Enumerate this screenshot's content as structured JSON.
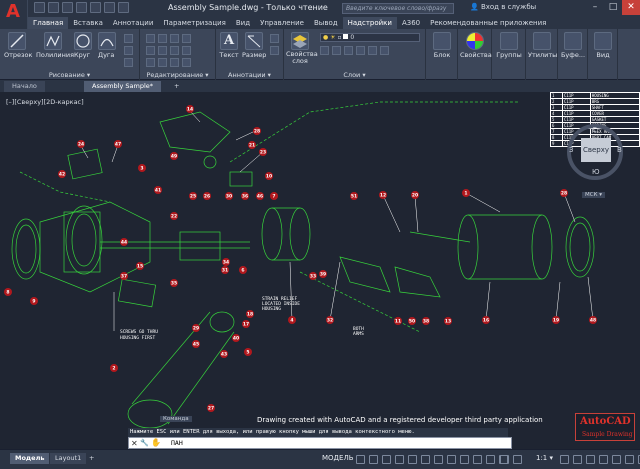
{
  "title_bar": {
    "window_title": "Assembly Sample.dwg - Только чтение",
    "search_placeholder": "Введите ключевое слово/фразу",
    "signin": "Вход в службы",
    "min": "–",
    "max": "□",
    "close": "✕"
  },
  "ribbon_tabs": [
    "Главная",
    "Вставка",
    "Аннотации",
    "Параметризация",
    "Вид",
    "Управление",
    "Вывод",
    "Надстройки",
    "A360",
    "Рекомендованные приложения"
  ],
  "ribbon": {
    "draw": {
      "line": "Отрезок",
      "polyline": "Полилиния",
      "circle": "Круг",
      "arc": "Дуга",
      "group_label": "Рисование ▾"
    },
    "modify": {
      "group_label": "Редактирование ▾"
    },
    "annotation": {
      "text": "Текст",
      "dimension": "Размер",
      "group_label": "Аннотации ▾"
    },
    "layers": {
      "layer_props": "Свойства слоя",
      "layer_value": "0",
      "group_label": "Слои ▾"
    },
    "block": {
      "label": "Блок"
    },
    "properties": {
      "label": "Свойства"
    },
    "groups": {
      "label": "Группы"
    },
    "utilities": {
      "label": "Утилиты"
    },
    "clipboard": {
      "label": "Буфе..."
    },
    "view": {
      "label": "Вид"
    }
  },
  "file_tabs": {
    "start": "Начало",
    "document": "Assembly Sample*",
    "add": "+"
  },
  "canvas": {
    "viewport_label": "[–][Сверху][2D-каркас]",
    "viewcube": {
      "north": "С",
      "south": "Ю",
      "west": "З",
      "east": "В",
      "face": "Сверху",
      "wcs": "МСК ▾"
    },
    "parts_table": [
      [
        "1",
        "C11P",
        "HOUSING"
      ],
      [
        "2",
        "C11P",
        "BRG"
      ],
      [
        "3",
        "C11P",
        "SHAFT"
      ],
      [
        "4",
        "C11P",
        "COVER"
      ],
      [
        "5",
        "C11P",
        "GASKET"
      ],
      [
        "6",
        "C11P",
        "SPRING"
      ],
      [
        "7",
        "C11P",
        "FLEX ARM"
      ],
      [
        "8",
        "C11P",
        "VERT CAM"
      ],
      [
        "9",
        "C11P",
        "RIVET"
      ]
    ],
    "notes": [
      {
        "lines": [
          "SCREWS GO THRU",
          "HOUSING FIRST"
        ]
      },
      {
        "lines": [
          "STRAIN RELIEF",
          "LOCATED INSIDE",
          "HOUSING"
        ]
      },
      {
        "lines": [
          "BOTH",
          "ARMS"
        ]
      }
    ],
    "balloons": [
      "24",
      "47",
      "14",
      "28",
      "21",
      "23",
      "49",
      "10",
      "25",
      "26",
      "30",
      "36",
      "46",
      "7",
      "3",
      "8",
      "9",
      "44",
      "15",
      "37",
      "35",
      "31",
      "6",
      "33",
      "39",
      "32",
      "4",
      "18",
      "17",
      "40",
      "5",
      "2",
      "27",
      "12",
      "20",
      "1",
      "28",
      "16",
      "19",
      "48",
      "11",
      "50",
      "38",
      "13",
      "22",
      "43",
      "29",
      "34",
      "45",
      "42",
      "41",
      "51"
    ],
    "credit": "Drawing created with AutoCAD and a registered developer third party application",
    "logo_title": "AutoCAD",
    "logo_sub": "Sample Drawing"
  },
  "command": {
    "history_label": "Команда",
    "prompt": "Нажмите ESC или ENTER для выхода, или правую кнопку мыши для вывода контекстного меню.",
    "input": "ПАН"
  },
  "status_bar": {
    "model_tab": "Модель",
    "layout_tab": "Layout1",
    "add": "+",
    "mode": "МОДЕЛЬ",
    "scale": "1:1 ▾"
  },
  "colors": {
    "balloon": "#b1181d",
    "geometry": "#37d23c",
    "background": "#1f2532"
  }
}
